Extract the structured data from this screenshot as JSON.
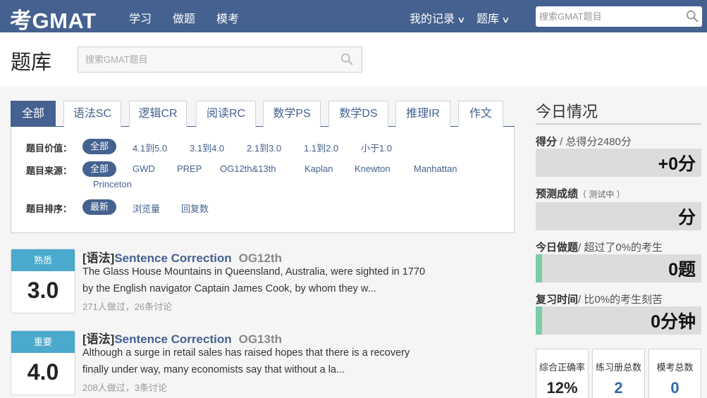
{
  "nav": {
    "logo": "考GMAT",
    "links": [
      "学习",
      "做题",
      "模考"
    ],
    "my_records": "我的记录",
    "question_bank": "题库",
    "search_placeholder": "搜索GMAT题目"
  },
  "page": {
    "title": "题库",
    "search_placeholder": "搜索GMAT题目"
  },
  "tabs": [
    "全部",
    "语法SC",
    "逻辑CR",
    "阅读RC",
    "数学PS",
    "数学DS",
    "推理IR",
    "作文"
  ],
  "filters": {
    "value": {
      "label": "题目价值：",
      "options": [
        "全部",
        "4.1到5.0",
        "3.1到4.0",
        "2.1到3.0",
        "1.1到2.0",
        "小于1.0"
      ]
    },
    "source": {
      "label": "题目来源：",
      "options": [
        "全部",
        "GWD",
        "PREP",
        "OG12th&13th",
        "Kaplan",
        "Knewton",
        "Manhattan",
        "Princeton"
      ]
    },
    "sort": {
      "label": "题目排序：",
      "options": [
        "最新",
        "浏览量",
        "回复数"
      ]
    }
  },
  "questions": [
    {
      "tag": "熟悉",
      "score": "3.0",
      "category": "[语法]",
      "type": "Sentence Correction",
      "source": "OG12th",
      "line1": "The Glass House Mountains in Queensland, Australia, were sighted in 1770",
      "line2": "by the English navigator Captain James Cook, by whom they w...",
      "meta": "271人做过，26条讨论"
    },
    {
      "tag": "重要",
      "score": "4.0",
      "category": "[语法]",
      "type": "Sentence Correction",
      "source": "OG13th",
      "line1": "Although a surge in retail sales has raised hopes that there is a recovery",
      "line2": "finally under way, many economists say that without a la...",
      "meta": "208人做过，3条讨论"
    }
  ],
  "sidebar": {
    "title": "今日情况",
    "score": {
      "label": "得分",
      "sub": " / 总得分2480分",
      "value": "+0分"
    },
    "predict": {
      "label": "预测成绩",
      "sub": "（ 测试中 ）",
      "value": "分"
    },
    "today_done": {
      "label": "今日做题",
      "sub": "/ 超过了0%的考生",
      "value": "0题",
      "fill": 0.04
    },
    "review": {
      "label": "复习时间",
      "sub": "/ 比0%的考生刻苦",
      "value": "0分钟",
      "fill": 0.04
    },
    "stats": [
      {
        "label": "综合正确率",
        "value": "12%",
        "color": "#222222"
      },
      {
        "label": "练习册总数",
        "value": "2",
        "color": "#2e6aa8"
      },
      {
        "label": "模考总数",
        "value": "0",
        "color": "#2e6aa8"
      }
    ]
  }
}
